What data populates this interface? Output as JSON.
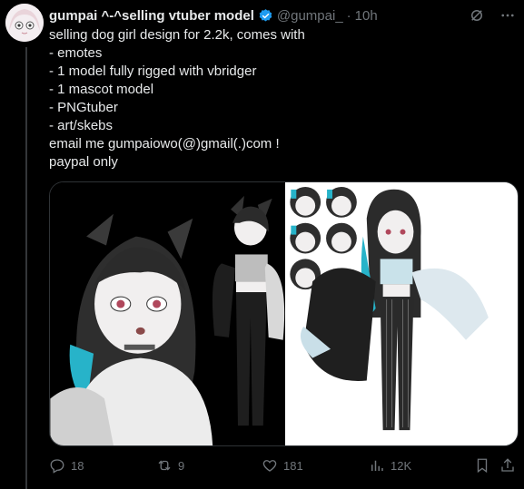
{
  "author": {
    "display_name": "gumpai ^-^selling vtuber model",
    "handle": "@gumpai_",
    "separator": "·",
    "time": "10h"
  },
  "tweet": {
    "lines": [
      "selling dog girl design for 2.2k, comes with",
      "- emotes",
      "- 1 model fully rigged with vbridger",
      "- 1 mascot model",
      "- PNGtuber",
      "- art/skebs",
      "email me gumpaiowo(@)gmail(.)com !",
      "paypal only"
    ]
  },
  "actions": {
    "replies": "18",
    "reposts": "9",
    "likes": "181",
    "views": "12K"
  },
  "colors": {
    "background": "#000000",
    "text": "#e7e9ea",
    "muted": "#71767b",
    "verified": "#1d9bf0",
    "border": "#2f3336"
  },
  "icons": [
    "verified-badge-icon",
    "grok-icon",
    "more-icon",
    "reply-icon",
    "repost-icon",
    "like-icon",
    "views-icon",
    "bookmark-icon",
    "share-icon"
  ]
}
